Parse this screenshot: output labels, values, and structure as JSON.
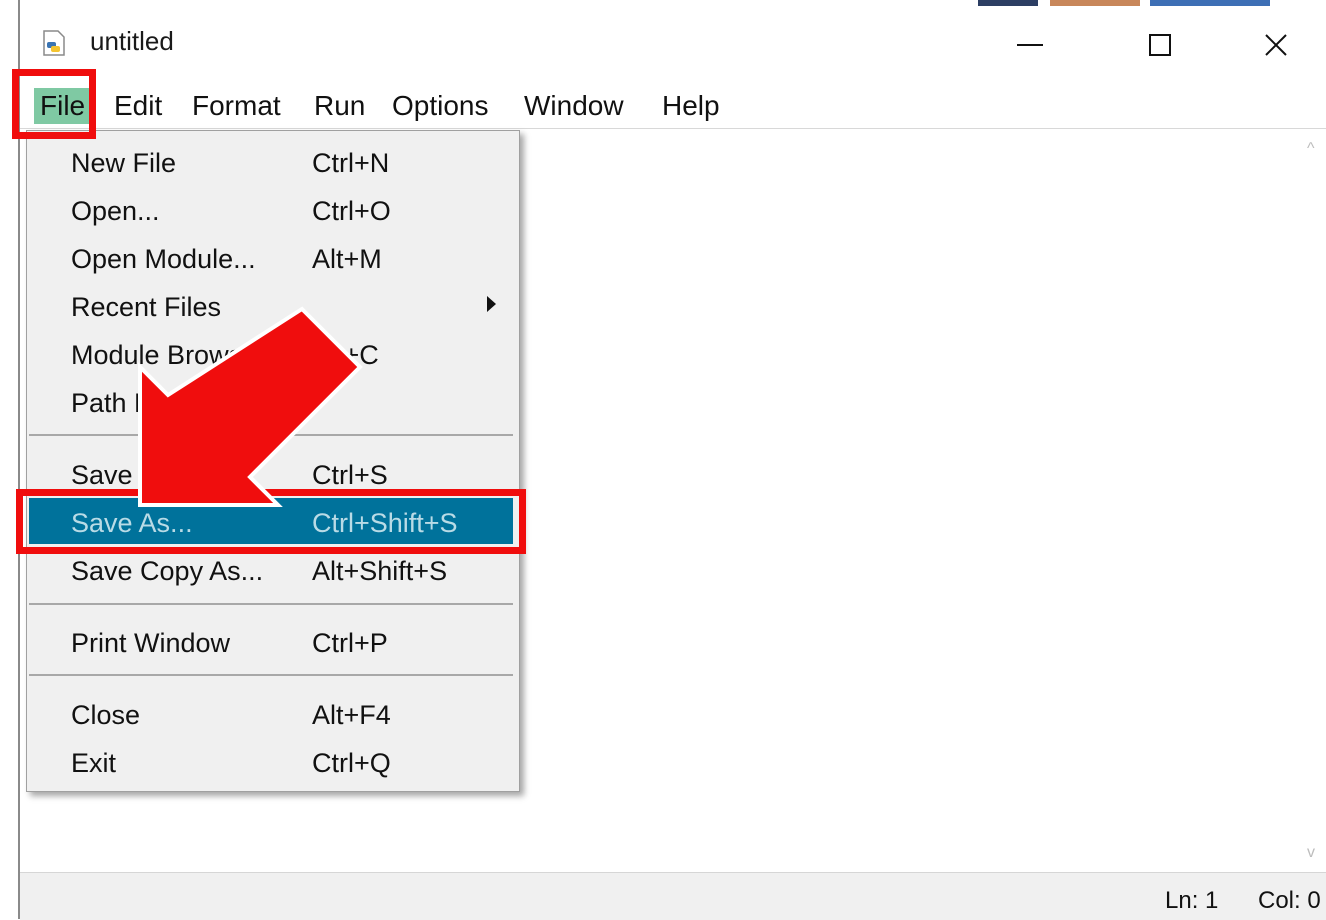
{
  "window": {
    "title": "untitled",
    "app_icon": "python-idle-icon",
    "controls": [
      "minimize",
      "maximize",
      "close"
    ]
  },
  "menubar": {
    "items": [
      {
        "label": "File",
        "active": true
      },
      {
        "label": "Edit"
      },
      {
        "label": "Format"
      },
      {
        "label": "Run"
      },
      {
        "label": "Options"
      },
      {
        "label": "Window"
      },
      {
        "label": "Help"
      }
    ]
  },
  "file_menu": {
    "items": [
      {
        "label": "New File",
        "shortcut": "Ctrl+N"
      },
      {
        "label": "Open...",
        "shortcut": "Ctrl+O"
      },
      {
        "label": "Open Module...",
        "shortcut": "Alt+M"
      },
      {
        "label": "Recent Files",
        "shortcut": "",
        "submenu": true
      },
      {
        "label": "Module Browser",
        "shortcut": "Alt+C"
      },
      {
        "label": "Path Browser",
        "shortcut": ""
      },
      {
        "label": "Save",
        "shortcut": "Ctrl+S"
      },
      {
        "label": "Save As...",
        "shortcut": "Ctrl+Shift+S",
        "highlighted": true
      },
      {
        "label": "Save Copy As...",
        "shortcut": "Alt+Shift+S"
      },
      {
        "label": "Print Window",
        "shortcut": "Ctrl+P"
      },
      {
        "label": "Close",
        "shortcut": "Alt+F4"
      },
      {
        "label": "Exit",
        "shortcut": "Ctrl+Q"
      }
    ]
  },
  "statusbar": {
    "line": "Ln: 1",
    "column": "Col: 0"
  },
  "colors": {
    "highlight": "#00729b",
    "highlight_text": "#b9dbe6",
    "active_menu": "#7fc9a3",
    "annotation": "#f00d0d",
    "menu_bg": "#f0f0f0"
  }
}
